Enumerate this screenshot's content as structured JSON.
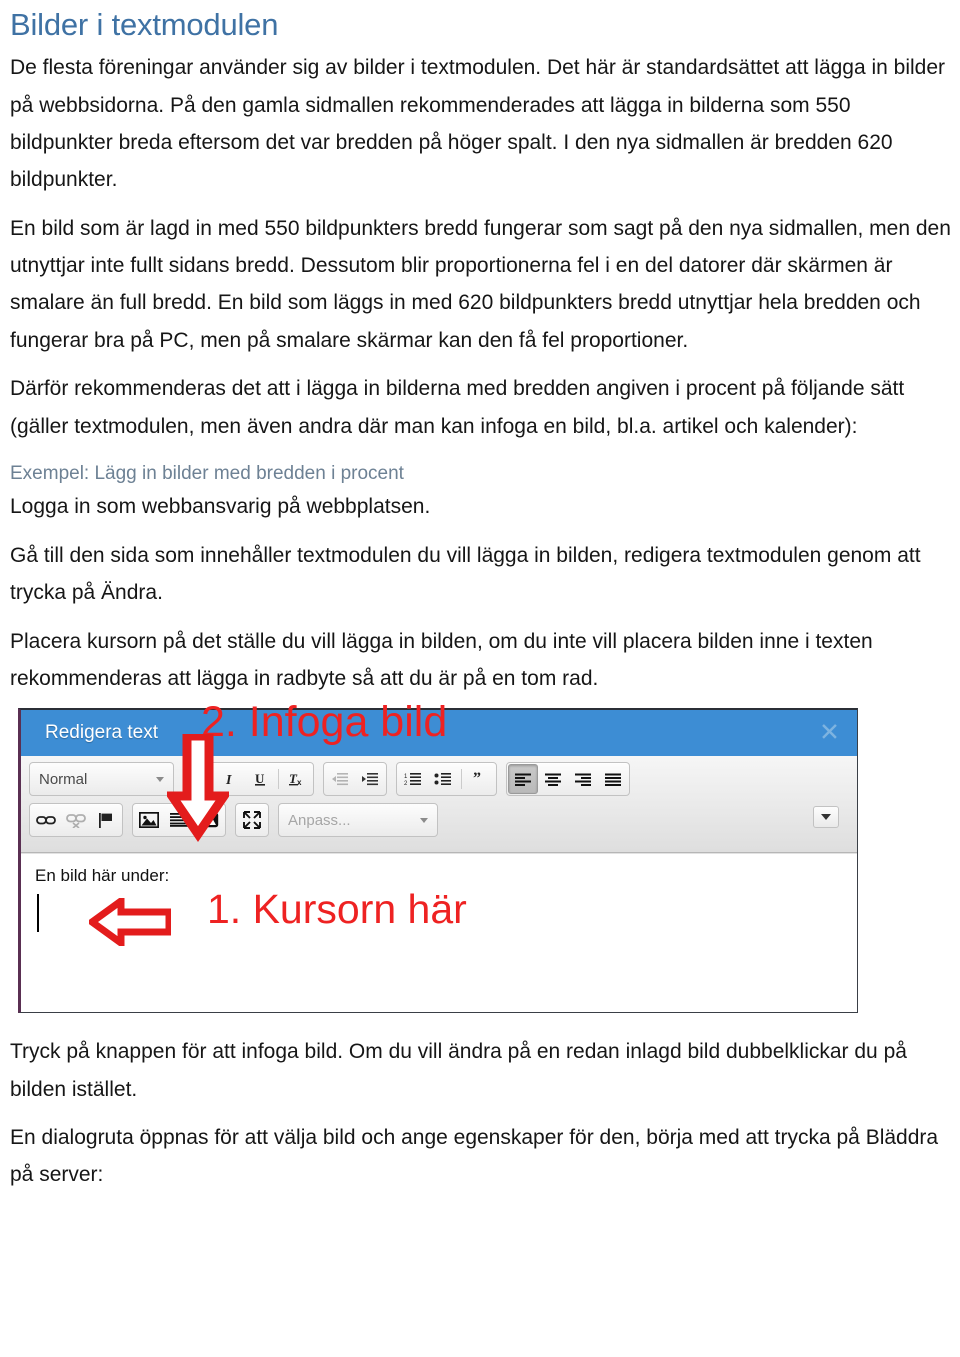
{
  "document": {
    "title": "Bilder i textmodulen",
    "paragraphs": [
      "De flesta föreningar använder sig av bilder i textmodulen. Det här är standardsättet att lägga in bilder på webbsidorna. På den gamla sidmallen rekommenderades att lägga in bilderna som 550 bildpunkter breda eftersom det var bredden på höger spalt. I den nya sidmallen är bredden 620 bildpunkter.",
      "En bild som är lagd in med 550 bildpunkters bredd fungerar som sagt på den nya sidmallen, men den utnyttjar inte fullt sidans bredd. Dessutom blir proportionerna fel i en del datorer där skärmen är smalare än full bredd. En bild som läggs in med 620 bildpunkters bredd utnyttjar hela bredden och fungerar bra på PC, men på smalare skärmar kan den få fel proportioner.",
      "Därför rekommenderas det att i lägga in bilderna med bredden angiven i procent på följande sätt (gäller textmodulen, men även andra där man kan infoga en bild, bl.a. artikel och kalender):"
    ],
    "example_link": "Exempel: Lägg in bilder med bredden i procent",
    "step_login": "Logga in som webbansvarig på webbplatsen.",
    "step_goto": "Gå till den sida som innehåller textmodulen du vill lägga in bilden, redigera textmodulen genom att trycka på Ändra.",
    "step_cursor": "Placera kursorn på det ställe du vill lägga in bilden, om du inte vill placera bilden inne i texten rekommenderas att lägga in radbyte så att du är på en tom rad.",
    "step_press": "Tryck på knappen för att infoga bild. Om du vill ändra på en redan inlagd bild dubbelklickar du på bilden istället.",
    "step_dialog": "En dialogruta öppnas för att välja bild och ange egenskaper för den, börja med att trycka på Bläddra på server:"
  },
  "editor_screenshot": {
    "titlebar": {
      "title": "Redigera text",
      "close_label": "✕"
    },
    "annotations": {
      "step2": "2. Infoga bild",
      "step1": "1. Kursorn här"
    },
    "toolbar": {
      "style_select": "Normal",
      "anpass_select": "Anpass...",
      "row1_buttons": [
        "bold-button",
        "italic-button",
        "underline-button",
        "remove-format-button",
        "decrease-indent-button",
        "increase-indent-button",
        "numbered-list-button",
        "bulleted-list-button",
        "blockquote-button",
        "align-left-button",
        "align-center-button",
        "align-right-button",
        "align-justify-button"
      ],
      "row2_buttons": [
        "link-button",
        "unlink-button",
        "anchor-button",
        "insert-image-button",
        "horizontal-rule-button",
        "insert-media-button",
        "maximize-button"
      ]
    },
    "content": {
      "body_text": "En bild här under:"
    }
  },
  "colors": {
    "heading": "#3f72a4",
    "link": "#6d8194",
    "annotation_red": "#ee2222",
    "titlebar_blue": "#3d8dd4"
  }
}
